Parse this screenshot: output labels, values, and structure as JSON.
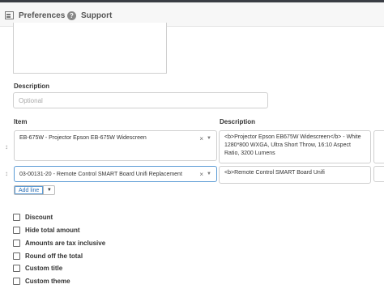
{
  "topbar": {
    "preferences_label": "Preferences",
    "support_label": "Support",
    "support_icon_glyph": "?"
  },
  "form": {
    "description_label": "Description",
    "description_placeholder": "Optional"
  },
  "lines": {
    "item_header": "Item",
    "description_header": "Description",
    "rows": [
      {
        "item": "EB-675W - Projector Epson EB-675W Widescreen",
        "description": "<b>Projector Epson EB675W Widescreen</b> - White 1280*800 WXGA, Ultra Short Throw, 16:10 Aspect Ratio, 3200 Lumens"
      },
      {
        "item": "03-00131-20 - Remote Control SMART Board Unifi Replacement",
        "description": "<b>Remote Control SMART Board Unifi"
      }
    ],
    "clear_glyph": "×",
    "caret_glyph": "▼",
    "drag_glyph": "↕",
    "add_line_label": "Add line",
    "add_line_caret": "▼"
  },
  "options": [
    {
      "label": "Discount",
      "checked": false
    },
    {
      "label": "Hide total amount",
      "checked": false
    },
    {
      "label": "Amounts are tax inclusive",
      "checked": false
    },
    {
      "label": "Round off the total",
      "checked": false
    },
    {
      "label": "Custom title",
      "checked": false
    },
    {
      "label": "Custom theme",
      "checked": false
    }
  ]
}
